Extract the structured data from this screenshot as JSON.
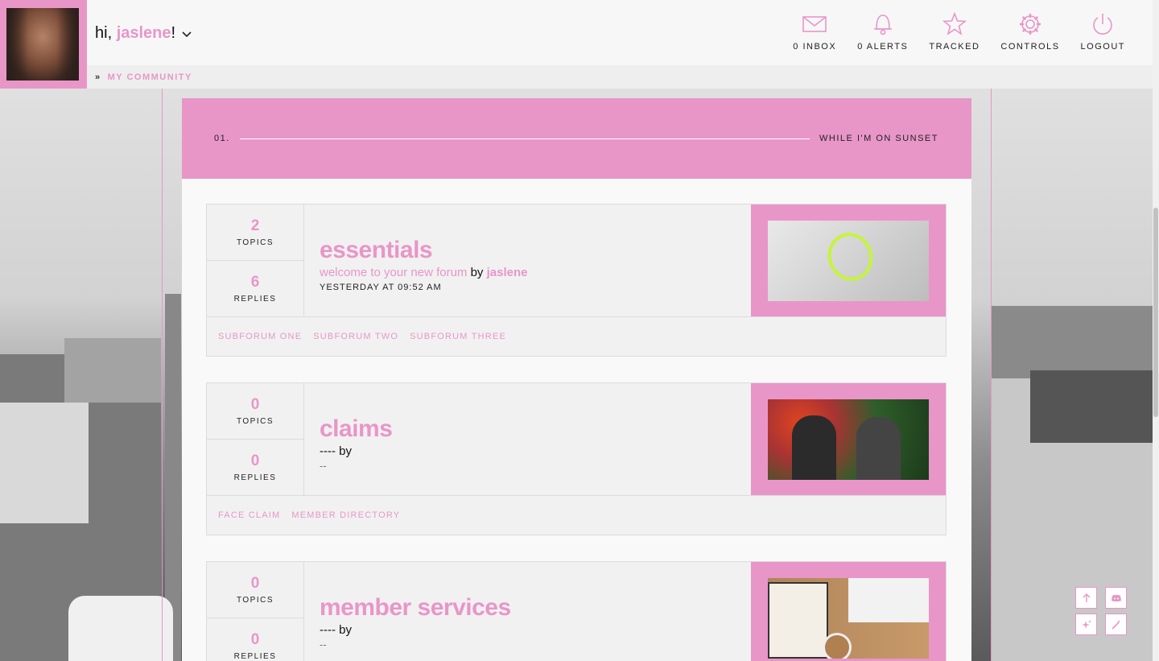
{
  "header": {
    "greeting_prefix": "hi,",
    "username": "jaslene",
    "greeting_suffix": "!",
    "nav": [
      {
        "label": "0 INBOX",
        "icon": "envelope-icon"
      },
      {
        "label": "0 ALERTS",
        "icon": "bell-icon"
      },
      {
        "label": "TRACKED",
        "icon": "star-icon"
      },
      {
        "label": "CONTROLS",
        "icon": "gear-icon"
      },
      {
        "label": "LOGOUT",
        "icon": "power-icon"
      }
    ]
  },
  "breadcrumb": {
    "separator": "»",
    "current": "MY COMMUNITY"
  },
  "category": {
    "number": "01.",
    "name": "WHILE I'M ON SUNSET"
  },
  "forums": [
    {
      "title": "essentials",
      "topics": "2",
      "topics_label": "TOPICS",
      "replies": "6",
      "replies_label": "REPLIES",
      "last_post": "welcome to your new forum",
      "by": "by",
      "last_user": "jaslene",
      "last_date": "YESTERDAY AT 09:52 AM",
      "subforums": [
        "SUBFORUM ONE",
        "SUBFORUM TWO",
        "SUBFORUM THREE"
      ]
    },
    {
      "title": "claims",
      "topics": "0",
      "topics_label": "TOPICS",
      "replies": "0",
      "replies_label": "REPLIES",
      "last_post": "----",
      "by": "by",
      "dash": "--",
      "subforums": [
        "FACE CLAIM",
        "MEMBER DIRECTORY"
      ]
    },
    {
      "title": "member services",
      "topics": "0",
      "topics_label": "TOPICS",
      "replies": "0",
      "replies_label": "REPLIES",
      "last_post": "----",
      "by": "by",
      "dash": "--",
      "subforums": []
    }
  ],
  "floating_buttons": [
    "arrow-up-icon",
    "discord-icon",
    "sparkle-icon",
    "wand-icon"
  ],
  "colors": {
    "accent": "#e896c8",
    "panel": "#f1f1f1",
    "header_bg": "#f7f7f7"
  }
}
